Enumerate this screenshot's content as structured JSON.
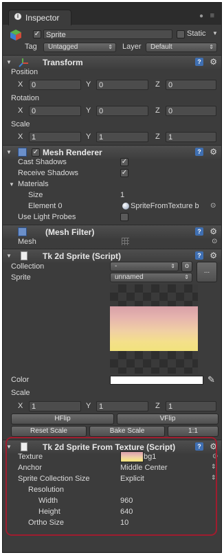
{
  "window": {
    "tab_title": "Inspector"
  },
  "object": {
    "name": "Sprite",
    "static_label": "Static",
    "tag_label": "Tag",
    "tag_value": "Untagged",
    "layer_label": "Layer",
    "layer_value": "Default",
    "active": true
  },
  "transform": {
    "title": "Transform",
    "position": {
      "label": "Position",
      "x": "0",
      "y": "0",
      "z": "0"
    },
    "rotation": {
      "label": "Rotation",
      "x": "0",
      "y": "0",
      "z": "0"
    },
    "scale": {
      "label": "Scale",
      "x": "1",
      "y": "1",
      "z": "1"
    }
  },
  "axis": {
    "x": "X",
    "y": "Y",
    "z": "Z"
  },
  "mesh_renderer": {
    "title": "Mesh Renderer",
    "cast_shadows": "Cast Shadows",
    "receive_shadows": "Receive Shadows",
    "materials": "Materials",
    "size_label": "Size",
    "size_value": "1",
    "element_label": "Element 0",
    "element_value": "SpriteFromTexture b",
    "light_probes": "Use Light Probes"
  },
  "mesh_filter": {
    "title": "(Mesh Filter)",
    "mesh_label": "Mesh"
  },
  "tk2d_sprite": {
    "title": "Tk 2d Sprite (Script)",
    "collection_label": "Collection",
    "collection_value": "-",
    "collection_btn": "o",
    "sprite_label": "Sprite",
    "sprite_value": "unnamed",
    "more_btn": "...",
    "color_label": "Color",
    "scale_label": "Scale",
    "scale_x": "1",
    "scale_y": "1",
    "scale_z": "1",
    "hflip": "HFlip",
    "vflip": "VFlip",
    "reset_scale": "Reset Scale",
    "bake_scale": "Bake Scale",
    "one_to_one": "1:1"
  },
  "tk2d_from_texture": {
    "title": "Tk 2d Sprite From Texture (Script)",
    "texture_label": "Texture",
    "texture_value": "bg1",
    "anchor_label": "Anchor",
    "anchor_value": "Middle Center",
    "collection_size_label": "Sprite Collection Size",
    "collection_size_value": "Explicit",
    "resolution_label": "Resolution",
    "width_label": "Width",
    "width_value": "960",
    "height_label": "Height",
    "height_value": "640",
    "ortho_label": "Ortho Size",
    "ortho_value": "10"
  },
  "colors": {
    "panel": "#3c3c3c",
    "highlight": "#a01c2e",
    "help": "#3f6fb2"
  }
}
